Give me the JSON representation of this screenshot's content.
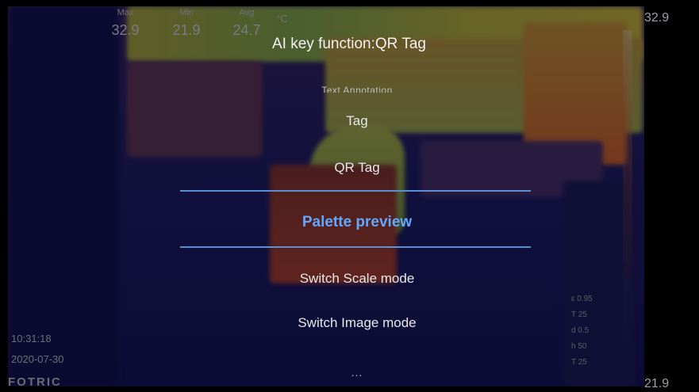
{
  "camera": {
    "stats": [
      {
        "label": "Max",
        "value": "32.9"
      },
      {
        "label": "Min",
        "value": "21.9"
      },
      {
        "label": "Avg",
        "value": "24.7"
      }
    ],
    "unit": "°C",
    "scale_max": "32.9",
    "scale_min": "21.9",
    "time": "10:31:18",
    "date": "2020-07-30",
    "brand": "FOTRIC",
    "params": [
      "ε 0.95",
      "T 25",
      "d 0.5",
      "h 50",
      "T 25"
    ]
  },
  "menu": {
    "title": "AI key function:QR Tag",
    "items": [
      "Text Annotation",
      "Tag",
      "QR Tag",
      "Palette preview",
      "Switch Scale mode",
      "Switch Image mode",
      "..."
    ],
    "selected_index": 3
  },
  "colors": {
    "selected": "#61a8ff",
    "selection_line": "#5d8ed4"
  }
}
